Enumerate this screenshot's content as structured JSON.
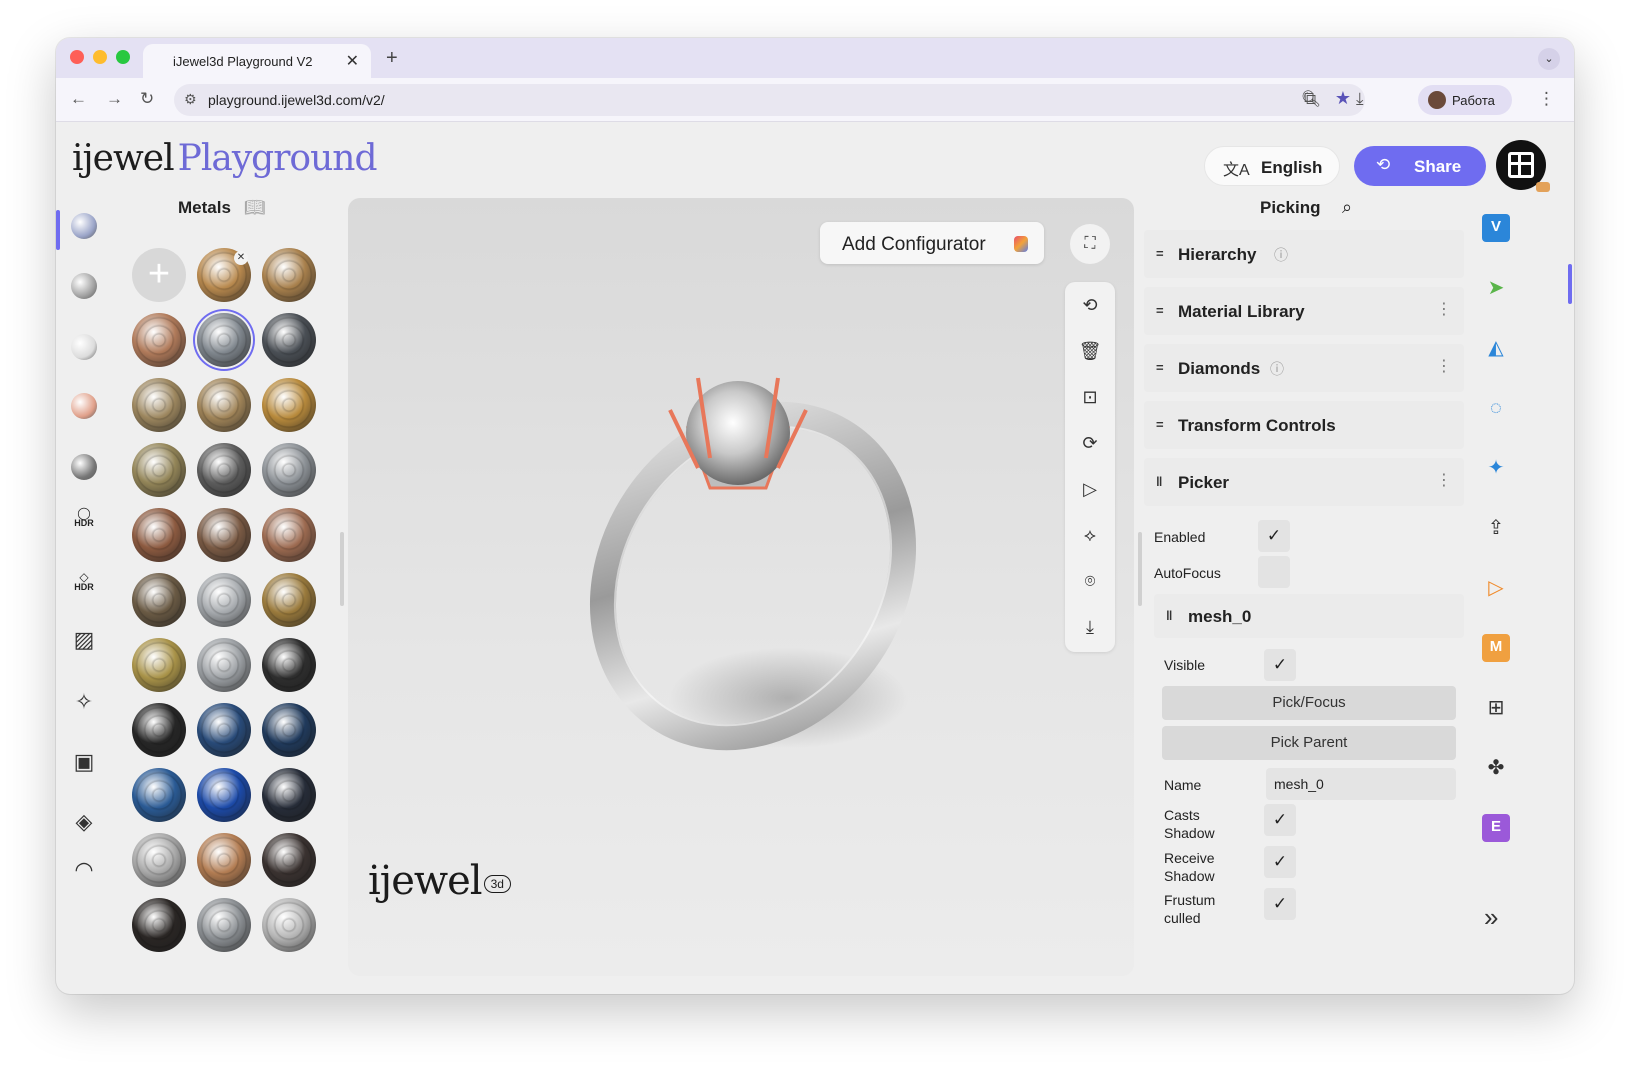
{
  "browser": {
    "tab_title": "iJewel3d Playground V2",
    "tab_close": "✕",
    "new_tab": "+",
    "url": "playground.ijewel3d.com/v2/",
    "profile_name": "Работа"
  },
  "header": {
    "logo_part1": "ijewel",
    "logo_part2": "Playground",
    "language_label": "English",
    "share_label": "Share"
  },
  "metals_panel": {
    "title": "Metals",
    "swatches": [
      {
        "kind": "add"
      },
      {
        "kind": "metal",
        "color": "#b8894e",
        "removable": true
      },
      {
        "kind": "metal",
        "color": "#a8804c"
      },
      {
        "kind": "metal",
        "color": "#b07a5a"
      },
      {
        "kind": "metal",
        "color": "#7f868d",
        "selected": true
      },
      {
        "kind": "metal",
        "color": "#4a4f55"
      },
      {
        "kind": "metal",
        "color": "#9c865e"
      },
      {
        "kind": "metal",
        "color": "#a08458"
      },
      {
        "kind": "metal",
        "color": "#b88a3c"
      },
      {
        "kind": "metal",
        "color": "#938558"
      },
      {
        "kind": "metal",
        "color": "#5c5c5c"
      },
      {
        "kind": "metal",
        "color": "#8c9196"
      },
      {
        "kind": "metal",
        "color": "#8c5a40"
      },
      {
        "kind": "metal",
        "color": "#7a5a44"
      },
      {
        "kind": "metal",
        "color": "#9c6a50"
      },
      {
        "kind": "metal",
        "color": "#6a5a44"
      },
      {
        "kind": "metal",
        "color": "#a4a8ac"
      },
      {
        "kind": "metal",
        "color": "#9a7a3c"
      },
      {
        "kind": "metal",
        "color": "#a89248"
      },
      {
        "kind": "metal",
        "color": "#9ca0a4"
      },
      {
        "kind": "metal",
        "color": "#2e2e2e"
      },
      {
        "kind": "metal",
        "color": "#262626"
      },
      {
        "kind": "metal",
        "color": "#284a78"
      },
      {
        "kind": "metal",
        "color": "#203a5c"
      },
      {
        "kind": "metal",
        "color": "#2a5a94"
      },
      {
        "kind": "metal",
        "color": "#1c4aa8"
      },
      {
        "kind": "metal",
        "color": "#262c38"
      },
      {
        "kind": "metal",
        "color": "#a8a8a8"
      },
      {
        "kind": "metal",
        "color": "#b27c52"
      },
      {
        "kind": "metal",
        "color": "#3a3230"
      },
      {
        "kind": "metal",
        "color": "#2a2624"
      },
      {
        "kind": "metal",
        "color": "#8c9094"
      },
      {
        "kind": "metal",
        "color": "#b4b4b4"
      }
    ]
  },
  "left_rail": {
    "items": [
      {
        "name": "metals-icon",
        "kind": "ball",
        "color": "#9aa4c8"
      },
      {
        "name": "gems-icon",
        "kind": "ball",
        "color": "#a0a0a0"
      },
      {
        "name": "pearl-icon",
        "kind": "ball",
        "color": "#dcdcdc"
      },
      {
        "name": "rose-ball-icon",
        "kind": "ball",
        "color": "#e0a08a"
      },
      {
        "name": "pattern-icon",
        "kind": "ball",
        "color": "#777777"
      },
      {
        "name": "hdr-ring-icon",
        "kind": "text",
        "glyph": "◯",
        "text": "HDR"
      },
      {
        "name": "hdr-diamond-icon",
        "kind": "text",
        "glyph": "◇",
        "text": "HDR"
      },
      {
        "name": "stripes-icon",
        "kind": "glyph",
        "glyph": "▨"
      },
      {
        "name": "sparkle-icon",
        "kind": "glyph",
        "glyph": "✧"
      },
      {
        "name": "image-frame-icon",
        "kind": "glyph",
        "glyph": "▣"
      },
      {
        "name": "plane-icon",
        "kind": "glyph",
        "glyph": "◈"
      },
      {
        "name": "ring-icon",
        "kind": "glyph",
        "glyph": "◠"
      }
    ],
    "collapse_glyph": "«"
  },
  "viewport": {
    "add_configurator_label": "Add Configurator",
    "brand_text": "ijewel",
    "brand_badge": "3d",
    "tools": [
      {
        "name": "rotate-view-icon",
        "glyph": "⟲"
      },
      {
        "name": "trash-icon",
        "glyph": "🗑"
      },
      {
        "name": "focus-icon",
        "glyph": "⊡"
      },
      {
        "name": "reset-view-icon",
        "glyph": "⟳"
      },
      {
        "name": "play-icon",
        "glyph": "▷"
      },
      {
        "name": "pivot-icon",
        "glyph": "⟡"
      },
      {
        "name": "camera-icon",
        "glyph": "⌾"
      },
      {
        "name": "download-icon",
        "glyph": "⤓"
      }
    ]
  },
  "right_panel": {
    "title": "Picking",
    "sections": {
      "hierarchy": "Hierarchy",
      "material_library": "Material Library",
      "diamonds": "Diamonds",
      "transform_controls": "Transform Controls",
      "picker": "Picker"
    },
    "picker": {
      "enabled_label": "Enabled",
      "enabled": true,
      "autofocus_label": "AutoFocus",
      "autofocus": false
    },
    "mesh": {
      "title": "mesh_0",
      "visible_label": "Visible",
      "visible": true,
      "pick_focus_label": "Pick/Focus",
      "pick_parent_label": "Pick Parent",
      "name_label": "Name",
      "name_value": "mesh_0",
      "casts_shadow_label_1": "Casts",
      "casts_shadow_label_2": "Shadow",
      "receive_shadow_label_1": "Receive",
      "receive_shadow_label_2": "Shadow",
      "frustum_label_1": "Frustum",
      "frustum_label_2": "culled",
      "check_glyph": "✓"
    }
  },
  "right_strip": {
    "items": [
      {
        "name": "v-badge-icon",
        "kind": "badge",
        "text": "V",
        "color": "#2b86d9"
      },
      {
        "name": "cursor-icon",
        "kind": "glyph",
        "glyph": "➤",
        "color": "#5ab54a"
      },
      {
        "name": "shapes-icon",
        "kind": "glyph",
        "glyph": "◭",
        "color": "#2b86d9"
      },
      {
        "name": "refresh-circle-icon",
        "kind": "glyph",
        "glyph": "◌",
        "color": "#2b86d9"
      },
      {
        "name": "star-icon",
        "kind": "glyph",
        "glyph": "✦",
        "color": "#2b86d9"
      },
      {
        "name": "upload-icon",
        "kind": "glyph",
        "glyph": "⇪",
        "color": "#333333"
      },
      {
        "name": "play-triangle-icon",
        "kind": "glyph",
        "glyph": "▷",
        "color": "#f08a2a"
      },
      {
        "name": "m-badge-icon",
        "kind": "badge",
        "text": "M",
        "color": "#f0a040"
      },
      {
        "name": "grid-icon",
        "kind": "glyph",
        "glyph": "⊞",
        "color": "#333333"
      },
      {
        "name": "puzzle-icon",
        "kind": "glyph",
        "glyph": "✤",
        "color": "#333333"
      },
      {
        "name": "e-badge-icon",
        "kind": "badge",
        "text": "E",
        "color": "#9b59d9"
      }
    ],
    "expand_glyph": "»"
  }
}
